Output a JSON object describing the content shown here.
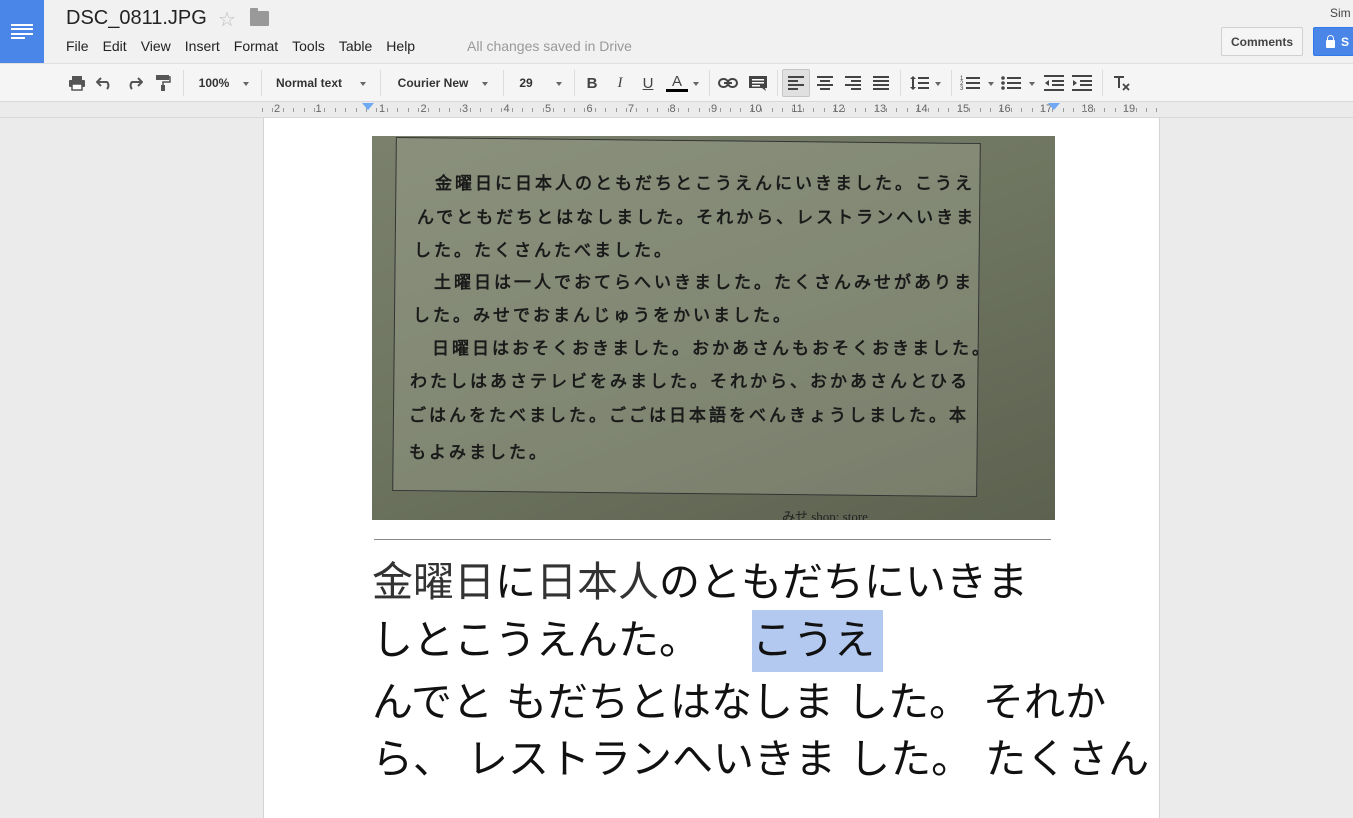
{
  "header": {
    "doc_title": "DSC_0811.JPG",
    "menus": [
      "File",
      "Edit",
      "View",
      "Insert",
      "Format",
      "Tools",
      "Table",
      "Help"
    ],
    "save_status": "All changes saved in Drive",
    "user_name": "Sim",
    "comments_label": "Comments",
    "share_label": "S"
  },
  "toolbar": {
    "zoom": "100%",
    "style": "Normal text",
    "font": "Courier New",
    "font_size": "29",
    "bold": "B",
    "italic": "I",
    "underline": "U",
    "text_color": "A",
    "clear_format": "Tx"
  },
  "ruler": {
    "labels": [
      "2",
      "1",
      "1",
      "2",
      "3",
      "4",
      "5",
      "6",
      "7",
      "8",
      "9",
      "10",
      "11",
      "12",
      "13",
      "14",
      "15",
      "16",
      "17",
      "18",
      "19"
    ]
  },
  "photo": {
    "lines": [
      "金曜日に日本人のともだちとこうえんにいきました。こうえ",
      "んでともだちとはなしました。それから、レストランへいきま",
      "した。たくさんたべました。",
      "土曜日は一人でおてらへいきました。たくさんみせがありま",
      "した。みせでおまんじゅうをかいました。",
      "日曜日はおそくおきました。おかあさんもおそくおきました。",
      "わたしはあさテレビをみました。それから、おかあさんとひる",
      "ごはんをたべました。ごごは日本語をべんきょうしました。本",
      "もよみました。"
    ],
    "footnote": "みせ      shop: store"
  },
  "document": {
    "line1_kanji": "金曜日",
    "line1_a": "に",
    "line1_kanji2": "日本人",
    "line1_b": "のともだちにいきま",
    "line2_a": "しとこうえんた。",
    "line2_selected": "こうえ",
    "line3": "んでと もだちとはなしま した。 それか",
    "line4": "ら、 レストランへいきま した。 たくさん"
  }
}
